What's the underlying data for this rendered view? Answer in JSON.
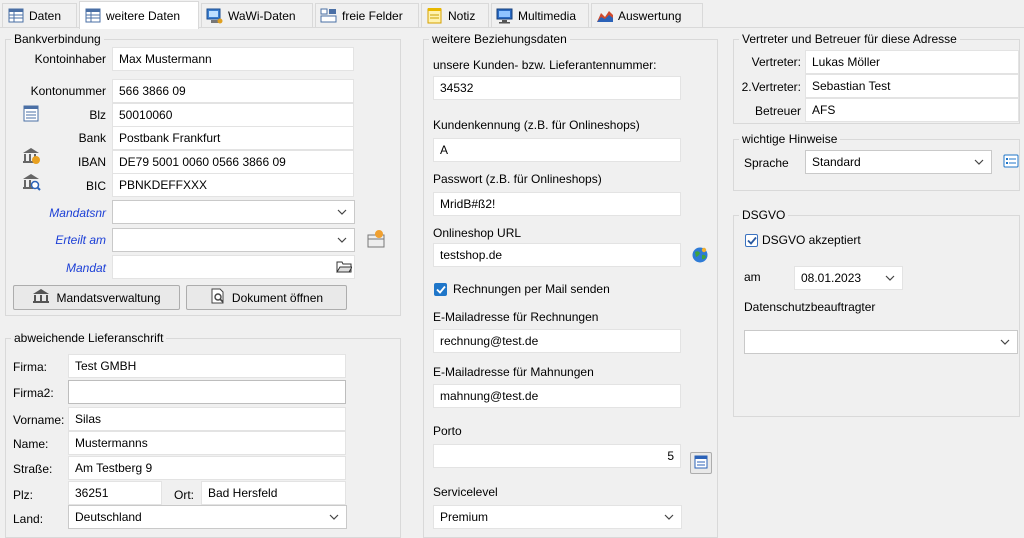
{
  "tabs": [
    {
      "label": "Daten",
      "icon": "table-icon"
    },
    {
      "label": "weitere Daten",
      "icon": "table-icon"
    },
    {
      "label": "WaWi-Daten",
      "icon": "computer-icon"
    },
    {
      "label": "freie Felder",
      "icon": "fields-icon"
    },
    {
      "label": "Notiz",
      "icon": "notepad-icon"
    },
    {
      "label": "Multimedia",
      "icon": "monitor-icon"
    },
    {
      "label": "Auswertung",
      "icon": "chart-icon"
    }
  ],
  "bank": {
    "legend": "Bankverbindung",
    "kontoinhaber_label": "Kontoinhaber",
    "kontoinhaber_value": "Max Mustermann",
    "kontonummer_label": "Kontonummer",
    "kontonummer_value": "566 3866 09",
    "blz_label": "Blz",
    "blz_value": "50010060",
    "bank_label": "Bank",
    "bank_value": "Postbank Frankfurt",
    "iban_label": "IBAN",
    "iban_value": "DE79 5001 0060 0566 3866 09",
    "bic_label": "BIC",
    "bic_value": "PBNKDEFFXXX",
    "mandatsnr_label": "Mandatsnr",
    "mandatsnr_value": "",
    "erteilt_label": "Erteilt am",
    "erteilt_value": "",
    "mandat_label": "Mandat",
    "mandat_value": "",
    "mandatsverwaltung_button": "Mandatsverwaltung",
    "dokument_button": "Dokument öffnen"
  },
  "liefer": {
    "legend": "abweichende Lieferanschrift",
    "firma_label": "Firma:",
    "firma_value": "Test GMBH",
    "firma2_label": "Firma2:",
    "firma2_value": "",
    "vorname_label": "Vorname:",
    "vorname_value": "Silas",
    "name_label": "Name:",
    "name_value": "Mustermanns",
    "strasse_label": "Straße:",
    "strasse_value": "Am Testberg 9",
    "plz_label": "Plz:",
    "plz_value": "36251",
    "ort_label": "Ort:",
    "ort_value": "Bad Hersfeld",
    "land_label": "Land:",
    "land_value": "Deutschland"
  },
  "beziehung": {
    "legend": "weitere Beziehungsdaten",
    "kundennr_label": "unsere Kunden- bzw. Lieferantennummer:",
    "kundennr_value": "34532",
    "kennung_label": "Kundenkennung (z.B. für Onlineshops)",
    "kennung_value": "A",
    "passwort_label": "Passwort (z.B. für Onlineshops)",
    "passwort_value": "MridB#ß2!",
    "url_label": "Onlineshop URL",
    "url_value": "testshop.de",
    "mail_checkbox_label": "Rechnungen per Mail senden",
    "mail_checked": true,
    "mail_rechnung_label": "E-Mailadresse für Rechnungen",
    "mail_rechnung_value": "rechnung@test.de",
    "mail_mahnung_label": "E-Mailadresse für Mahnungen",
    "mail_mahnung_value": "mahnung@test.de",
    "porto_label": "Porto",
    "porto_value": "5",
    "service_label": "Servicelevel",
    "service_value": "Premium"
  },
  "vertreter": {
    "legend": "Vertreter und Betreuer für diese Adresse",
    "vertreter_label": "Vertreter:",
    "vertreter_value": "Lukas Möller",
    "vertreter2_label": "2.Vertreter:",
    "vertreter2_value": "Sebastian Test",
    "betreuer_label": "Betreuer",
    "betreuer_value": "AFS"
  },
  "hinweise": {
    "legend": "wichtige Hinweise",
    "sprache_label": "Sprache",
    "sprache_value": "Standard"
  },
  "dsgvo": {
    "legend": "DSGVO",
    "akzeptiert_label": "DSGVO akzeptiert",
    "akzeptiert_checked": true,
    "am_label": "am",
    "am_value": "08.01.2023",
    "beauftragter_label": "Datenschutzbeauftragter",
    "beauftragter_value": ""
  },
  "colors": {
    "accent_blue": "#1f76c9",
    "link_label_blue": "#1c3fd6",
    "panel_bg": "#f0f0f0"
  }
}
